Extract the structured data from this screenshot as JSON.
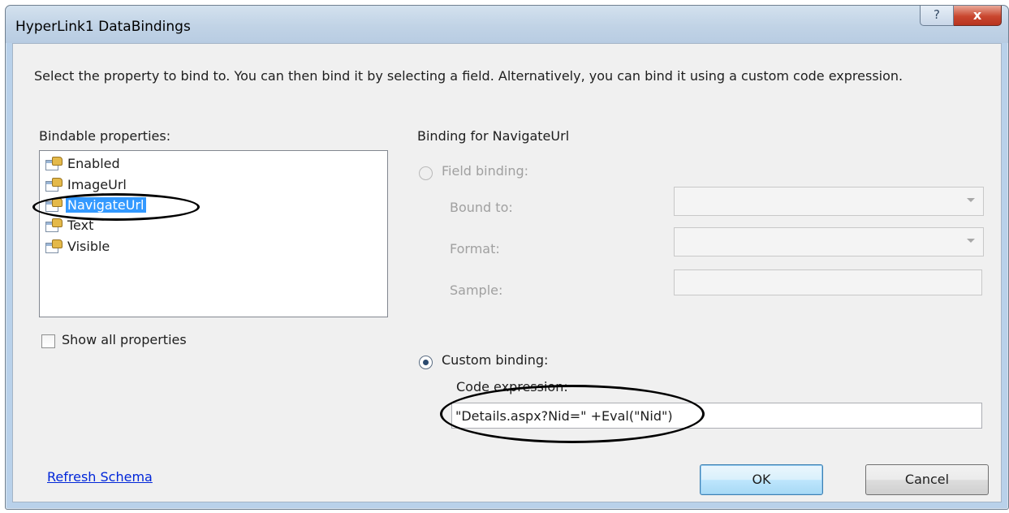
{
  "window": {
    "title": "HyperLink1 DataBindings",
    "help_glyph": "?",
    "close_glyph": "x"
  },
  "description": "Select the property to bind to. You can then bind it by selecting a field. Alternatively, you can bind it using a custom code expression.",
  "bindable": {
    "label": "Bindable properties:",
    "items": [
      {
        "label": "Enabled",
        "selected": false
      },
      {
        "label": "ImageUrl",
        "selected": false
      },
      {
        "label": "NavigateUrl",
        "selected": true
      },
      {
        "label": "Text",
        "selected": false
      },
      {
        "label": "Visible",
        "selected": false
      }
    ],
    "show_all_label": "Show all properties",
    "show_all_checked": false
  },
  "binding": {
    "heading": "Binding for NavigateUrl",
    "field_binding_label": "Field binding:",
    "field_binding_selected": false,
    "bound_to_label": "Bound to:",
    "bound_to_value": "",
    "format_label": "Format:",
    "format_value": "",
    "sample_label": "Sample:",
    "sample_value": "",
    "custom_binding_label": "Custom binding:",
    "custom_binding_selected": true,
    "code_expression_label": "Code expression:",
    "code_expression_value": "\"Details.aspx?Nid=\" +Eval(\"Nid\")"
  },
  "footer": {
    "refresh_schema": "Refresh Schema",
    "ok": "OK",
    "cancel": "Cancel"
  },
  "colors": {
    "selection": "#3399ff",
    "link": "#0026d9",
    "annotation": "#000000"
  }
}
